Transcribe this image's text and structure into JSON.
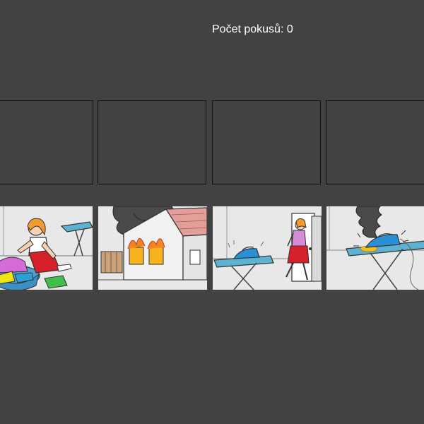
{
  "game": {
    "attempts_label": "Počet pokusů: 0"
  },
  "drop_slots": [
    {
      "name": "drop-slot-1"
    },
    {
      "name": "drop-slot-2"
    },
    {
      "name": "drop-slot-3"
    },
    {
      "name": "drop-slot-4"
    }
  ],
  "cards": [
    {
      "scene": "girl-sorting-laundry"
    },
    {
      "scene": "house-on-fire"
    },
    {
      "scene": "girl-leaving-iron-on"
    },
    {
      "scene": "iron-burning-board"
    }
  ],
  "colors": {
    "background": "#424242",
    "slot_border": "#111111",
    "card_background": "#e6e6e6",
    "text": "#ffffff"
  }
}
